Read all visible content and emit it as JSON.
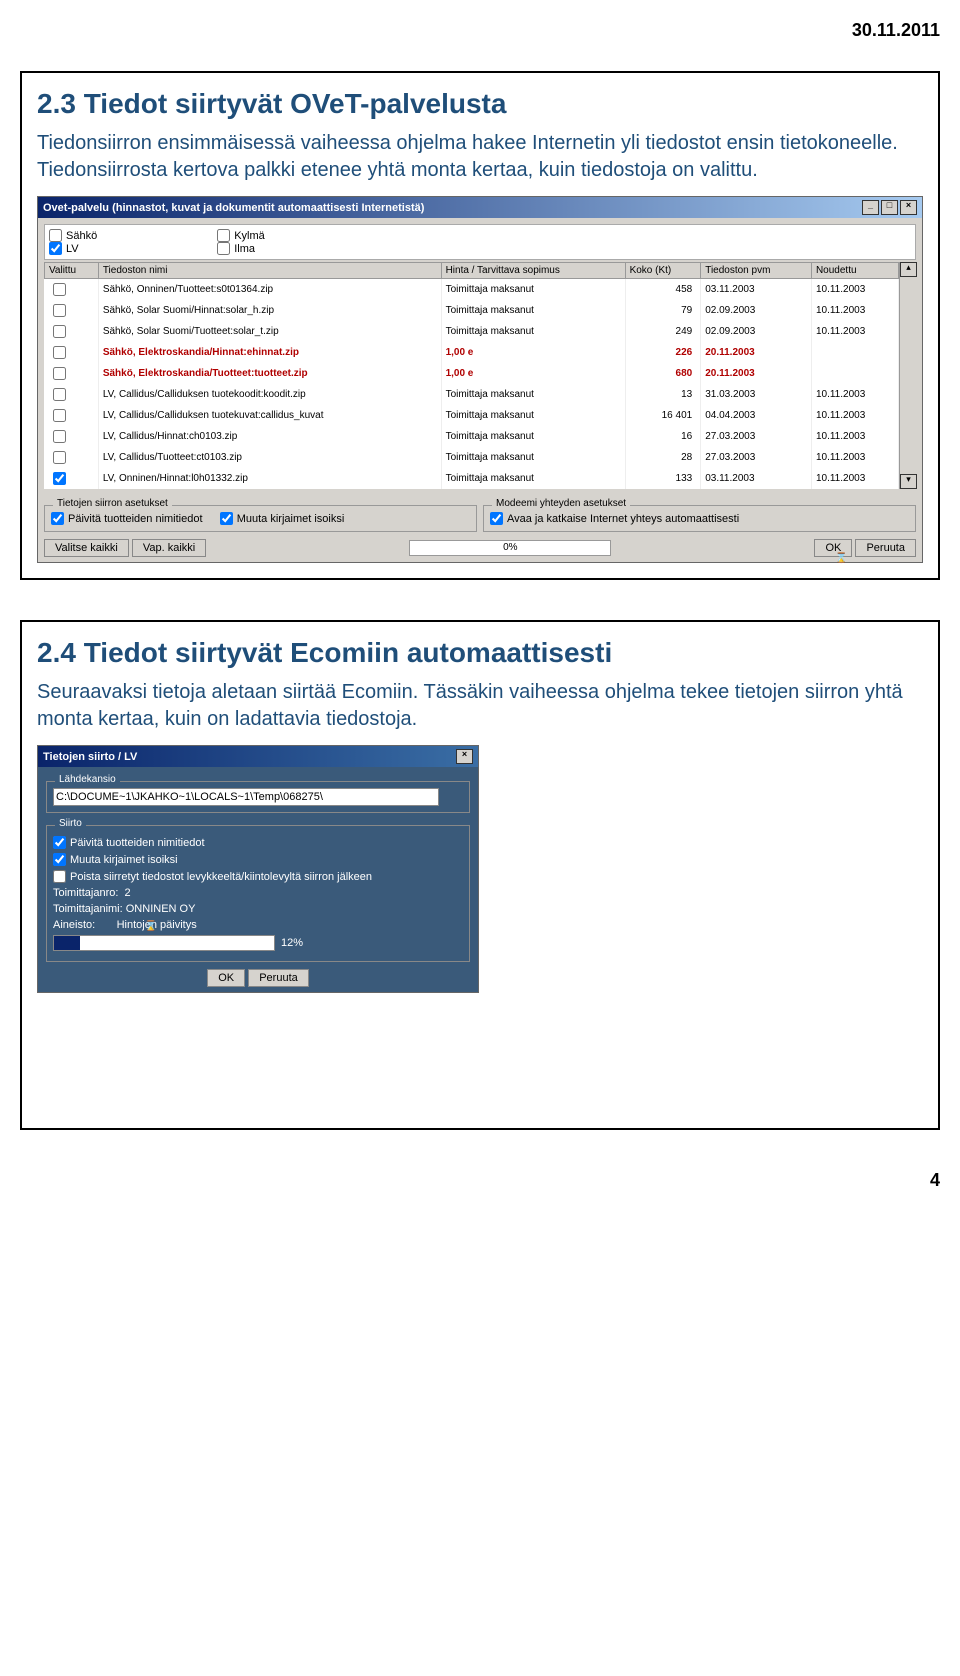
{
  "header_date": "30.11.2011",
  "page_number": "4",
  "slide1": {
    "title": "2.3 Tiedot siirtyvät OVeT-palvelusta",
    "body": "Tiedonsiirron ensimmäisessä vaiheessa ohjelma hakee Internetin yli tiedostot ensin tietokoneelle. Tiedonsiirrosta kertova palkki etenee yhtä monta kertaa, kuin tiedostoja on valittu.",
    "window_title": "Ovet-palvelu (hinnastot, kuvat ja dokumentit automaattisesti Internetistä)",
    "top_checks": {
      "sahko": "Sähkö",
      "lv": "LV",
      "kylma": "Kylmä",
      "ilma": "Ilma"
    },
    "columns": [
      "Valittu",
      "Tiedoston nimi",
      "Hinta / Tarvittava sopimus",
      "Koko (Kt)",
      "Tiedoston pvm",
      "Noudettu"
    ],
    "rows": [
      {
        "name": "Sähkö, Onninen/Tuotteet:s0t01364.zip",
        "price": "Toimittaja maksanut",
        "size": "458",
        "date": "03.11.2003",
        "fetched": "10.11.2003",
        "red": false
      },
      {
        "name": "Sähkö, Solar Suomi/Hinnat:solar_h.zip",
        "price": "Toimittaja maksanut",
        "size": "79",
        "date": "02.09.2003",
        "fetched": "10.11.2003",
        "red": false
      },
      {
        "name": "Sähkö, Solar Suomi/Tuotteet:solar_t.zip",
        "price": "Toimittaja maksanut",
        "size": "249",
        "date": "02.09.2003",
        "fetched": "10.11.2003",
        "red": false
      },
      {
        "name": "Sähkö, Elektroskandia/Hinnat:ehinnat.zip",
        "price": "1,00 e",
        "size": "226",
        "date": "20.11.2003",
        "fetched": "",
        "red": true
      },
      {
        "name": "Sähkö, Elektroskandia/Tuotteet:tuotteet.zip",
        "price": "1,00 e",
        "size": "680",
        "date": "20.11.2003",
        "fetched": "",
        "red": true
      },
      {
        "name": "LV, Callidus/Calliduksen tuotekoodit:koodit.zip",
        "price": "Toimittaja maksanut",
        "size": "13",
        "date": "31.03.2003",
        "fetched": "10.11.2003",
        "red": false
      },
      {
        "name": "LV, Callidus/Calliduksen tuotekuvat:callidus_kuvat",
        "price": "Toimittaja maksanut",
        "size": "16 401",
        "date": "04.04.2003",
        "fetched": "10.11.2003",
        "red": false
      },
      {
        "name": "LV, Callidus/Hinnat:ch0103.zip",
        "price": "Toimittaja maksanut",
        "size": "16",
        "date": "27.03.2003",
        "fetched": "10.11.2003",
        "red": false
      },
      {
        "name": "LV, Callidus/Tuotteet:ct0103.zip",
        "price": "Toimittaja maksanut",
        "size": "28",
        "date": "27.03.2003",
        "fetched": "10.11.2003",
        "red": false
      },
      {
        "name": "LV, Onninen/Hinnat:l0h01332.zip",
        "price": "Toimittaja maksanut",
        "size": "133",
        "date": "03.11.2003",
        "fetched": "10.11.2003",
        "red": false,
        "checked": true
      }
    ],
    "group1_legend": "Tietojen siirron asetukset",
    "group1_opt1": "Päivitä tuotteiden nimitiedot",
    "group1_opt2": "Muuta kirjaimet isoiksi",
    "group2_legend": "Modeemi yhteyden asetukset",
    "group2_opt1": "Avaa ja katkaise Internet yhteys automaattisesti",
    "btn_selectall": "Valitse kaikki",
    "btn_deselectall": "Vap. kaikki",
    "progress": "0%",
    "btn_ok": "OK",
    "btn_cancel": "Peruuta"
  },
  "slide2": {
    "title": "2.4 Tiedot siirtyvät Ecomiin automaattisesti",
    "body": "Seuraavaksi tietoja aletaan siirtää Ecomiin. Tässäkin vaiheessa ohjelma tekee tietojen siirron yhtä monta kertaa, kuin on ladattavia tiedostoja.",
    "dialog_title": "Tietojen siirto / LV",
    "group1_legend": "Lähdekansio",
    "path_value": "C:\\DOCUME~1\\JKAHKO~1\\LOCALS~1\\Temp\\068275\\",
    "group2_legend": "Siirto",
    "opt1": "Päivitä tuotteiden nimitiedot",
    "opt2": "Muuta kirjaimet isoiksi",
    "opt3": "Poista siirretyt tiedostot levykkeeltä/kiintolevyltä siirron jälkeen",
    "row_toimittajanro_label": "Toimittajanro:",
    "row_toimittajanro_value": "2",
    "row_toimittajanimi_label": "Toimittajanimi:",
    "row_toimittajanimi_value": "ONNINEN OY",
    "row_aineisto_label": "Aineisto:",
    "row_aineisto_value": "Hintojen päivitys",
    "progress": "12%",
    "btn_ok": "OK",
    "btn_cancel": "Peruuta"
  }
}
